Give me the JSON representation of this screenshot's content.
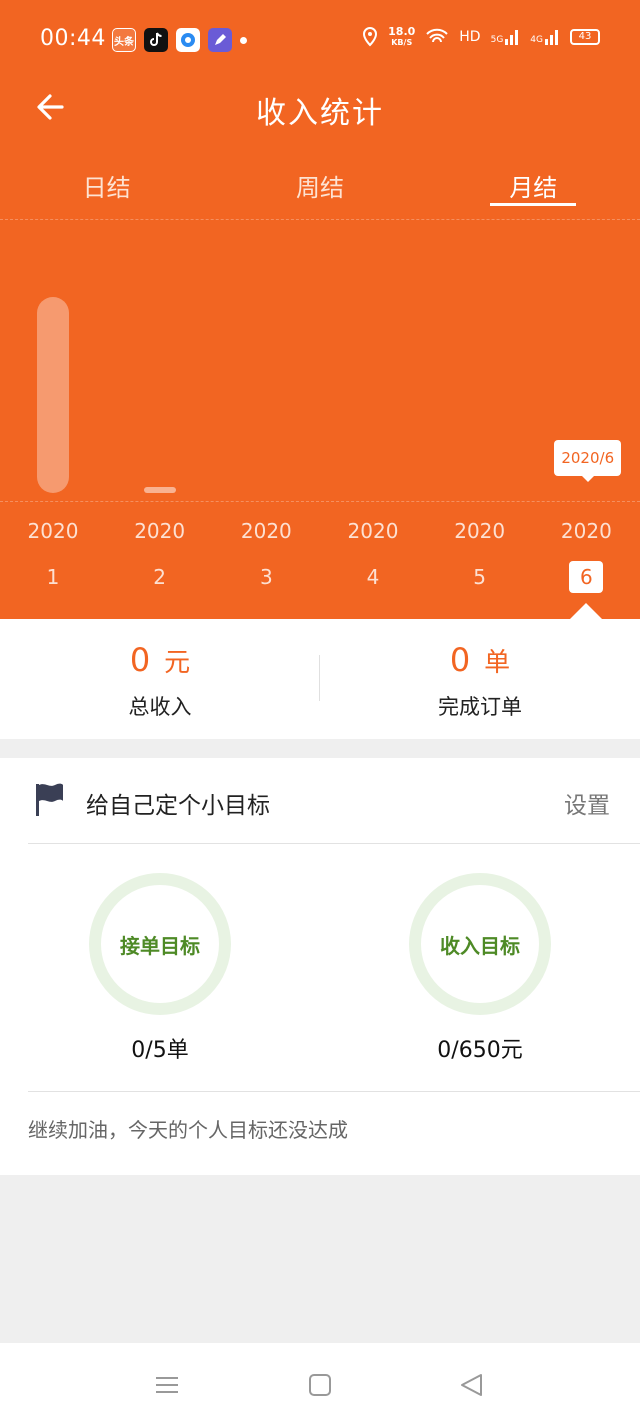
{
  "status_bar": {
    "time": "00:44",
    "app_badge": "头条",
    "net_speed": "18.0",
    "net_unit": "KB/S",
    "hd": "HD",
    "signal1": "5G",
    "signal2": "4G",
    "battery": "43"
  },
  "header": {
    "title": "收入统计"
  },
  "tabs": [
    {
      "label": "日结",
      "active": false
    },
    {
      "label": "周结",
      "active": false
    },
    {
      "label": "月结",
      "active": true
    }
  ],
  "chart_data": {
    "type": "bar",
    "categories": [
      "2020-1",
      "2020-2",
      "2020-3",
      "2020-4",
      "2020-5",
      "2020-6"
    ],
    "x_years": [
      "2020",
      "2020",
      "2020",
      "2020",
      "2020",
      "2020"
    ],
    "x_months": [
      "1",
      "2",
      "3",
      "4",
      "5",
      "6"
    ],
    "values": [
      1,
      0.02,
      0,
      0,
      0,
      0
    ],
    "selected_index": 5,
    "tooltip": "2020/6"
  },
  "summary": {
    "income_value": "0",
    "income_unit": "元",
    "income_label": "总收入",
    "orders_value": "0",
    "orders_unit": "单",
    "orders_label": "完成订单"
  },
  "goals": {
    "title": "给自己定个小目标",
    "set_label": "设置",
    "order_goal_label": "接单目标",
    "order_goal_value": "0/5单",
    "income_goal_label": "收入目标",
    "income_goal_value": "0/650元",
    "footer": "继续加油，今天的个人目标还没达成"
  },
  "colors": {
    "brand": "#f26522",
    "goal_green": "#4e8a26",
    "ring": "#e8f3e3"
  },
  "icons": [
    "back-arrow-icon",
    "flag-icon",
    "menu-icon",
    "home-icon",
    "back-icon"
  ]
}
